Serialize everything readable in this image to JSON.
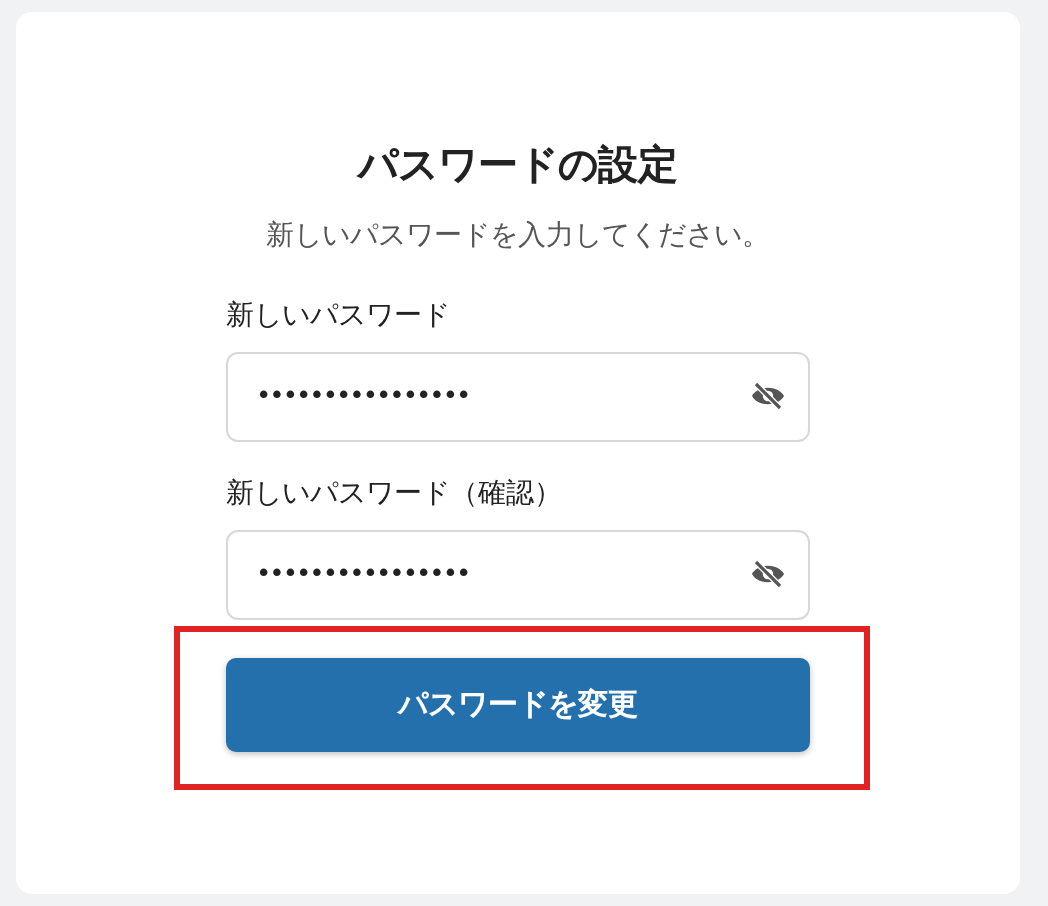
{
  "title": "パスワードの設定",
  "subtitle": "新しいパスワードを入力してください。",
  "fields": [
    {
      "label": "新しいパスワード",
      "value": "••••••••••••••••",
      "revealed": false
    },
    {
      "label": "新しいパスワード（確認）",
      "value": "••••••••••••••••",
      "revealed": false
    }
  ],
  "submit": {
    "label": "パスワードを変更",
    "highlighted": true
  }
}
